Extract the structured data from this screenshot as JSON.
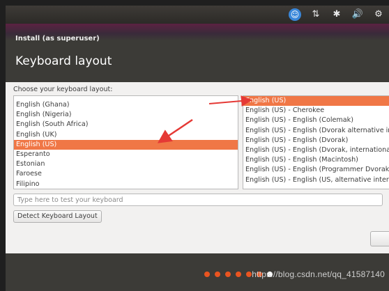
{
  "window": {
    "title": "Install (as superuser)"
  },
  "page": {
    "title": "Keyboard layout"
  },
  "tray": {
    "icons": [
      "accessibility-icon",
      "network-arrows-icon",
      "bluetooth-icon",
      "volume-icon",
      "settings-gear-icon"
    ],
    "accent": "#3a87d9"
  },
  "layout_prompt": "Choose your keyboard layout:",
  "layouts": [
    "English (Ghana)",
    "English (Nigeria)",
    "English (South Africa)",
    "English (UK)",
    "English (US)",
    "Esperanto",
    "Estonian",
    "Faroese",
    "Filipino"
  ],
  "selected_layout": "English (US)",
  "variants": [
    "English (US)",
    "English (US) - Cherokee",
    "English (US) - English (Colemak)",
    "English (US) - English (Dvorak alternative in",
    "English (US) - English (Dvorak)",
    "English (US) - English (Dvorak, internationa",
    "English (US) - English (Macintosh)",
    "English (US) - English (Programmer Dvorak",
    "English (US) - English (US, alternative intern"
  ],
  "selected_variant": "English (US)",
  "test_input": {
    "placeholder": "Type here to test your keyboard",
    "value": ""
  },
  "detect_button": "Detect Keyboard Layout",
  "progress": {
    "total_steps": 7,
    "highlighted_step": 7,
    "accent": "#e95420"
  },
  "watermark": "https://blog.csdn.net/qq_41587140",
  "annotation_color": "#e53935"
}
